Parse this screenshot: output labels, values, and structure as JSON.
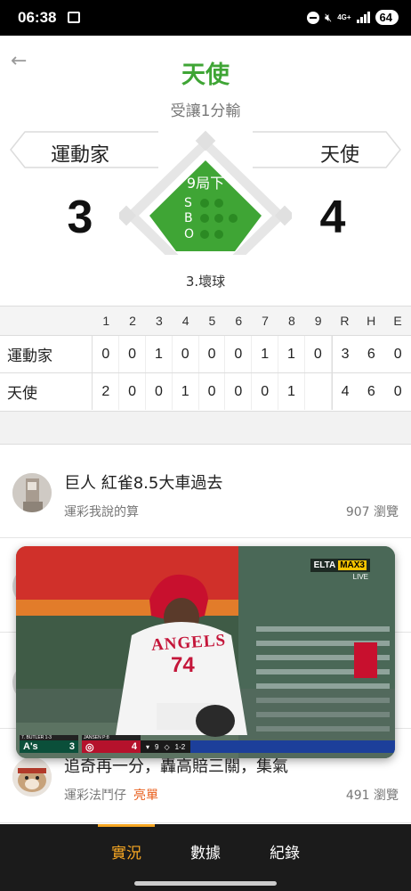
{
  "status_bar": {
    "time": "06:38",
    "network": "4G+",
    "battery": "64"
  },
  "header": {
    "title": "天使",
    "subtitle": "受讓1分輸"
  },
  "game": {
    "away_team": "運動家",
    "home_team": "天使",
    "away_score": "3",
    "home_score": "4",
    "inning": "9局下",
    "count_labels": [
      "S",
      "B",
      "O"
    ],
    "strikes": 0,
    "balls": 0,
    "outs": 0,
    "play": "3.壞球"
  },
  "linescore": {
    "headers": [
      "1",
      "2",
      "3",
      "4",
      "5",
      "6",
      "7",
      "8",
      "9",
      "R",
      "H",
      "E"
    ],
    "rows": [
      {
        "team": "運動家",
        "cells": [
          "0",
          "0",
          "1",
          "0",
          "0",
          "0",
          "1",
          "1",
          "0",
          "3",
          "6",
          "0"
        ]
      },
      {
        "team": "天使",
        "cells": [
          "2",
          "0",
          "0",
          "1",
          "0",
          "0",
          "0",
          "1",
          "",
          "4",
          "6",
          "0"
        ]
      }
    ]
  },
  "posts": [
    {
      "title": "巨人 紅雀8.5大車過去",
      "author": "運彩我說的算",
      "tag": "",
      "views": "907 瀏覽"
    },
    {
      "title": "追奇再一分，轟高賠三關，集氣",
      "author": "運彩法鬥仔",
      "tag": "亮單",
      "views": "491 瀏覽"
    }
  ],
  "video": {
    "broadcaster": "ELTA",
    "channel": "MAX3",
    "live": "LIVE",
    "jersey_text": "ANGELS",
    "jersey_number": "74",
    "away_abbr": "A's",
    "away_score": "3",
    "home_score": "4",
    "away_pitcher": "7. BUTLER 1-3",
    "home_pitcher": "JANSEN P:8",
    "inning": "9",
    "count": "1-2"
  },
  "bottom_nav": {
    "items": [
      "實況",
      "數據",
      "紀錄"
    ],
    "active": 0
  },
  "colors": {
    "accent_green": "#3fa535",
    "nav_active": "#f5a623",
    "hot_tag": "#e85d1a"
  }
}
